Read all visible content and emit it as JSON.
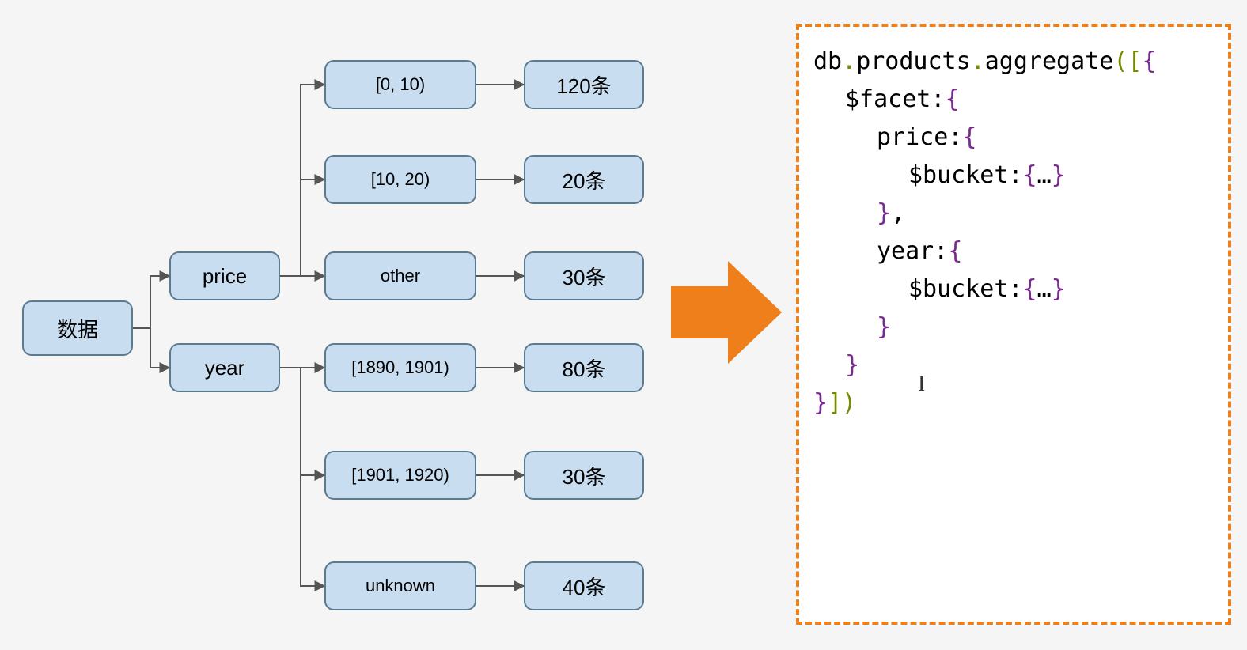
{
  "root": {
    "label": "数据"
  },
  "facets": {
    "price": {
      "label": "price"
    },
    "year": {
      "label": "year"
    }
  },
  "price_buckets": [
    {
      "range": "[0, 10)",
      "count": "120条"
    },
    {
      "range": "[10, 20)",
      "count": "20条"
    },
    {
      "range": "other",
      "count": "30条"
    }
  ],
  "year_buckets": [
    {
      "range": "[1890, 1901)",
      "count": "80条"
    },
    {
      "range": "[1901, 1920)",
      "count": "30条"
    },
    {
      "range": "unknown",
      "count": "40条"
    }
  ],
  "code": {
    "l1_db": "db",
    "l1_products": "products",
    "l1_aggregate": "aggregate",
    "l2_facet": "$facet",
    "l3_price": "price",
    "l4_bucket": "$bucket",
    "l4_ellipsis": "…",
    "l5_year": "year"
  }
}
